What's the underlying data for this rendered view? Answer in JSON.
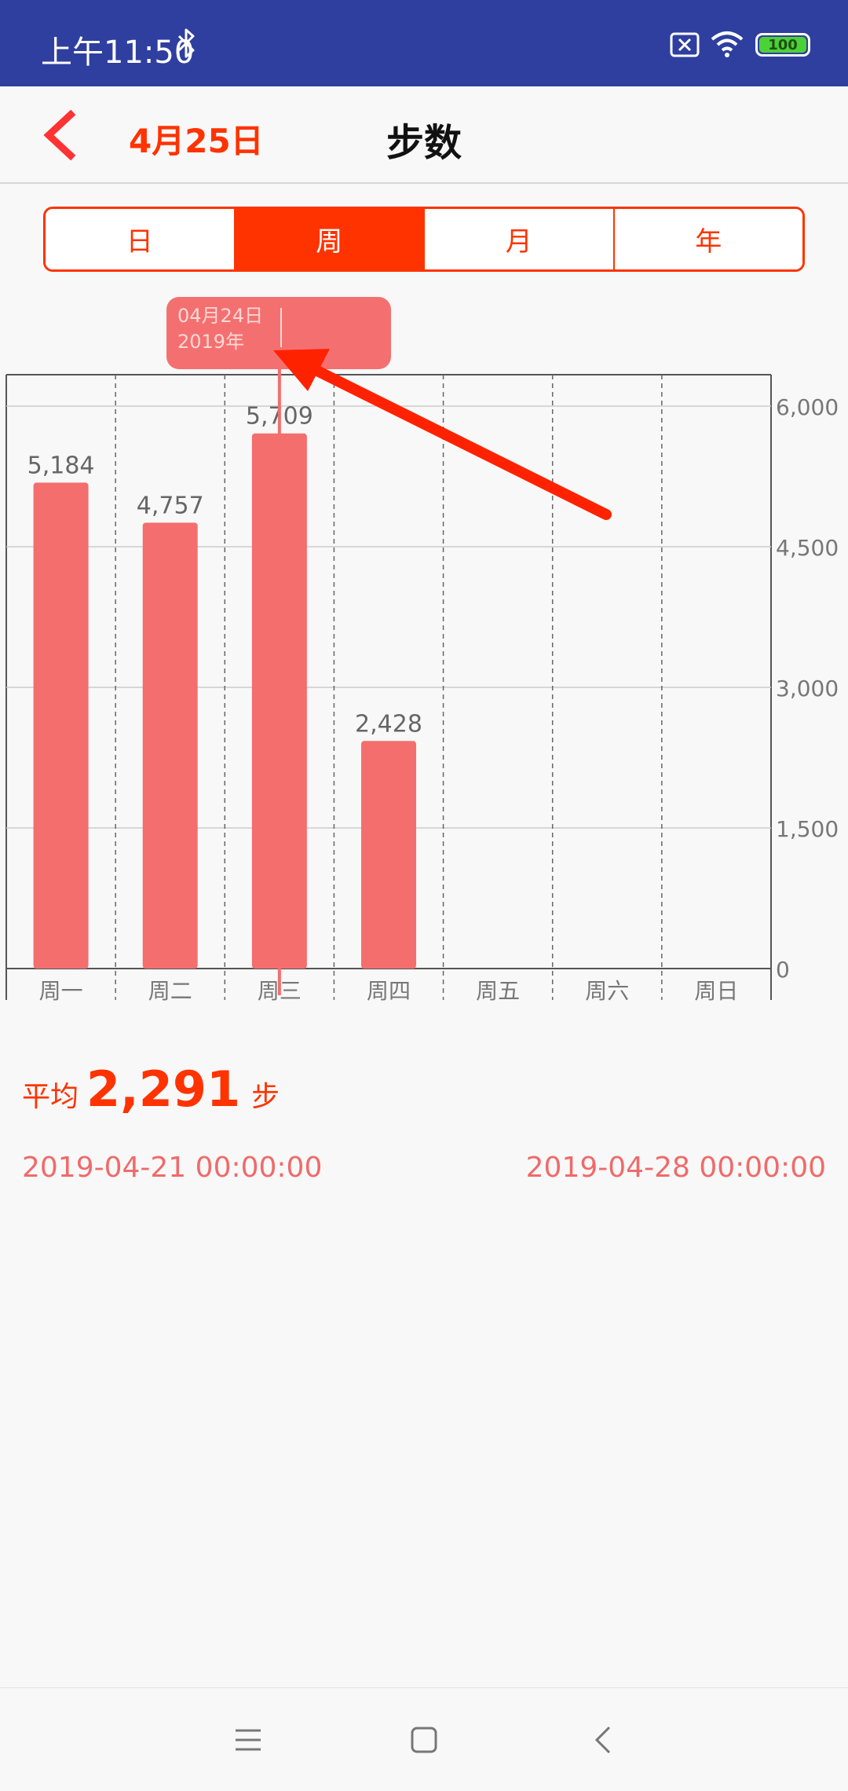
{
  "status_bar": {
    "time": "上午11:50",
    "battery_level": "100"
  },
  "header": {
    "date": "4月25日",
    "title": "步数"
  },
  "tabs": [
    {
      "label": "日",
      "active": false
    },
    {
      "label": "周",
      "active": true
    },
    {
      "label": "月",
      "active": false
    },
    {
      "label": "年",
      "active": false
    }
  ],
  "chart_data": {
    "type": "bar",
    "categories": [
      "周一",
      "周二",
      "周三",
      "周四",
      "周五",
      "周六",
      "周日"
    ],
    "values": [
      5184,
      4757,
      5709,
      2428,
      null,
      null,
      null
    ],
    "value_labels": [
      "5,184",
      "4,757",
      "5,709",
      "2,428",
      "",
      "",
      ""
    ],
    "y_ticks": [
      "0",
      "1,500",
      "3,000",
      "4,500",
      "6,000"
    ],
    "ylim": [
      0,
      6000
    ],
    "y_axis_side": "right",
    "bar_color": "#f46e6e",
    "tooltip": {
      "line1": "04月24日",
      "line2": "2019年"
    }
  },
  "summary": {
    "avg_label": "平均",
    "avg_value": "2,291",
    "unit": "步",
    "range_start": "2019-04-21 00:00:00",
    "range_end": "2019-04-28 00:00:00"
  },
  "colors": {
    "accent": "#ff3300",
    "status_bar": "#2f3f9f",
    "bar": "#f46e6e",
    "tooltip_bg": "#f47070",
    "annotation_arrow": "#ff2200"
  }
}
